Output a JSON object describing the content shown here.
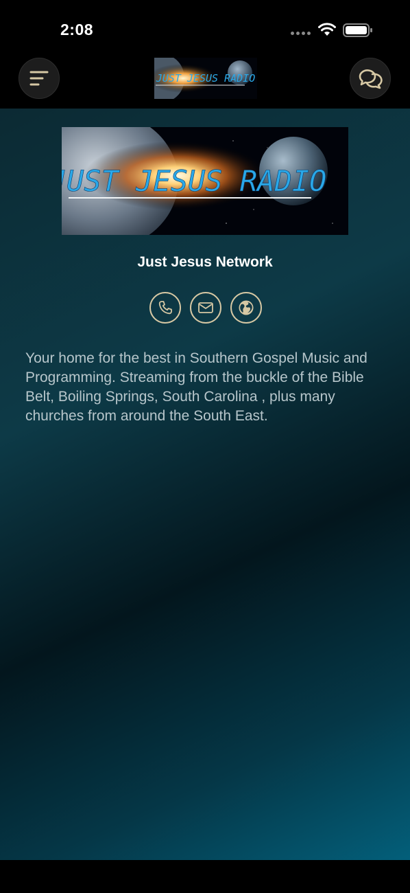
{
  "status_bar": {
    "time": "2:08"
  },
  "header": {
    "menu_icon": "menu-icon",
    "chat_icon": "chat-bubbles-icon",
    "logo_text": "JUST JESUS RADIO"
  },
  "station": {
    "banner_text": "JUST JESUS RADIO",
    "name": "Just Jesus Network",
    "description": "Your home for the best in Southern Gospel Music and Programming. Streaming from the buckle of the Bible Belt, Boiling Springs, South Carolina , plus many churches from around the South East."
  },
  "contact": {
    "icons": [
      "phone-icon",
      "mail-icon",
      "globe-icon"
    ]
  },
  "colors": {
    "accent": "#d6c8a4",
    "logo_text": "#2aa8e8",
    "background_top": "#0c2a33",
    "background_bottom": "#035f7a"
  }
}
